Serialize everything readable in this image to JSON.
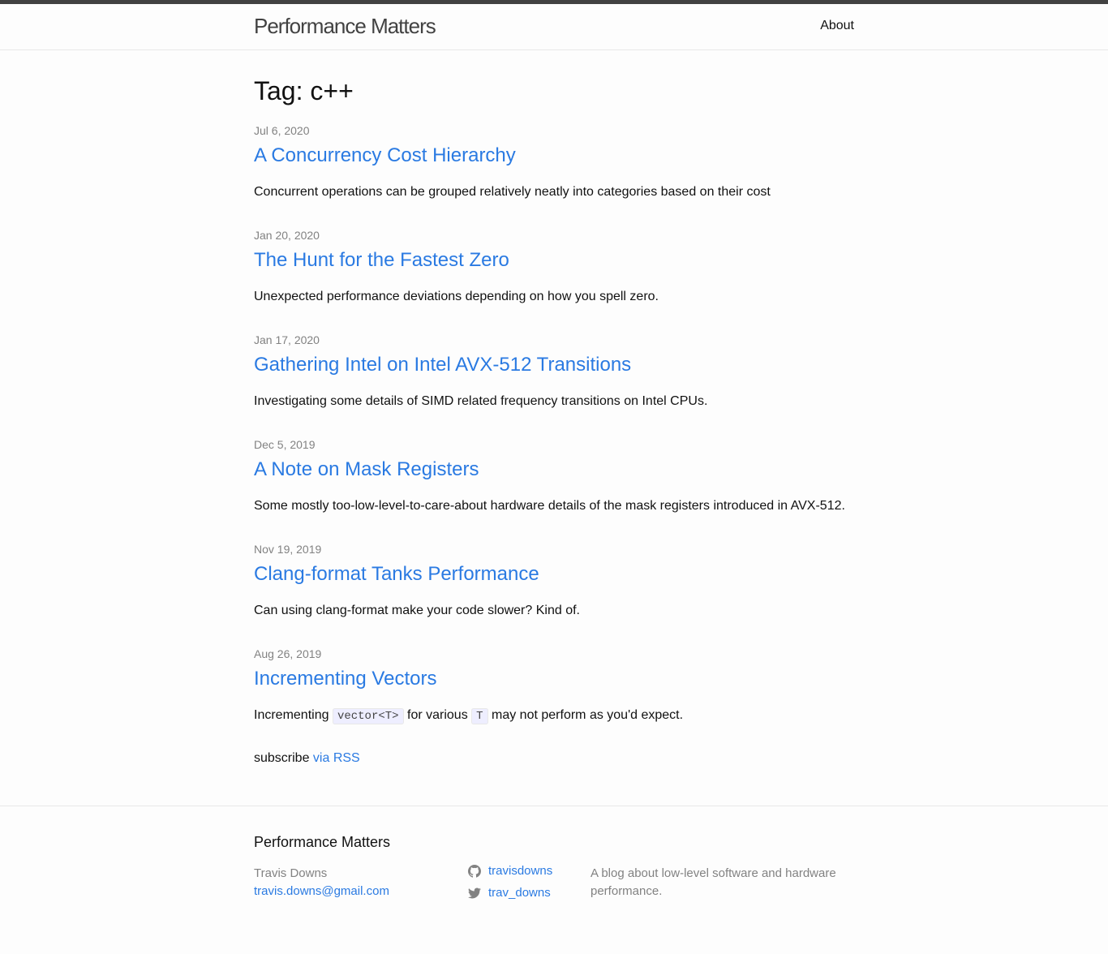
{
  "header": {
    "site_title": "Performance Matters",
    "nav": {
      "about": "About"
    }
  },
  "page": {
    "heading": "Tag: c++"
  },
  "posts": [
    {
      "date": "Jul 6, 2020",
      "title": "A Concurrency Cost Hierarchy",
      "excerpt": "Concurrent operations can be grouped relatively neatly into categories based on their cost"
    },
    {
      "date": "Jan 20, 2020",
      "title": "The Hunt for the Fastest Zero",
      "excerpt": "Unexpected performance deviations depending on how you spell zero."
    },
    {
      "date": "Jan 17, 2020",
      "title": "Gathering Intel on Intel AVX-512 Transitions",
      "excerpt": "Investigating some details of SIMD related frequency transitions on Intel CPUs."
    },
    {
      "date": "Dec 5, 2019",
      "title": "A Note on Mask Registers",
      "excerpt": "Some mostly too-low-level-to-care-about hardware details of the mask registers introduced in AVX-512."
    },
    {
      "date": "Nov 19, 2019",
      "title": "Clang-format Tanks Performance",
      "excerpt": "Can using clang-format make your code slower? Kind of."
    },
    {
      "date": "Aug 26, 2019",
      "title": "Incrementing Vectors",
      "excerpt_parts": {
        "a": "Incrementing ",
        "code1": "vector<T>",
        "b": " for various ",
        "code2": "T",
        "c": " may not perform as you'd expect."
      }
    }
  ],
  "subscribe": {
    "prefix": "subscribe ",
    "link": "via RSS"
  },
  "footer": {
    "heading": "Performance Matters",
    "author": "Travis Downs",
    "email": "travis.downs@gmail.com",
    "github": {
      "icon": "github-icon",
      "username": "travisdowns"
    },
    "twitter": {
      "icon": "twitter-icon",
      "username": "trav_downs"
    },
    "description": "A blog about low-level software and hardware performance."
  },
  "colors": {
    "link": "#2a7ae2",
    "meta": "#828282",
    "text": "#111111",
    "topbar": "#424242"
  }
}
